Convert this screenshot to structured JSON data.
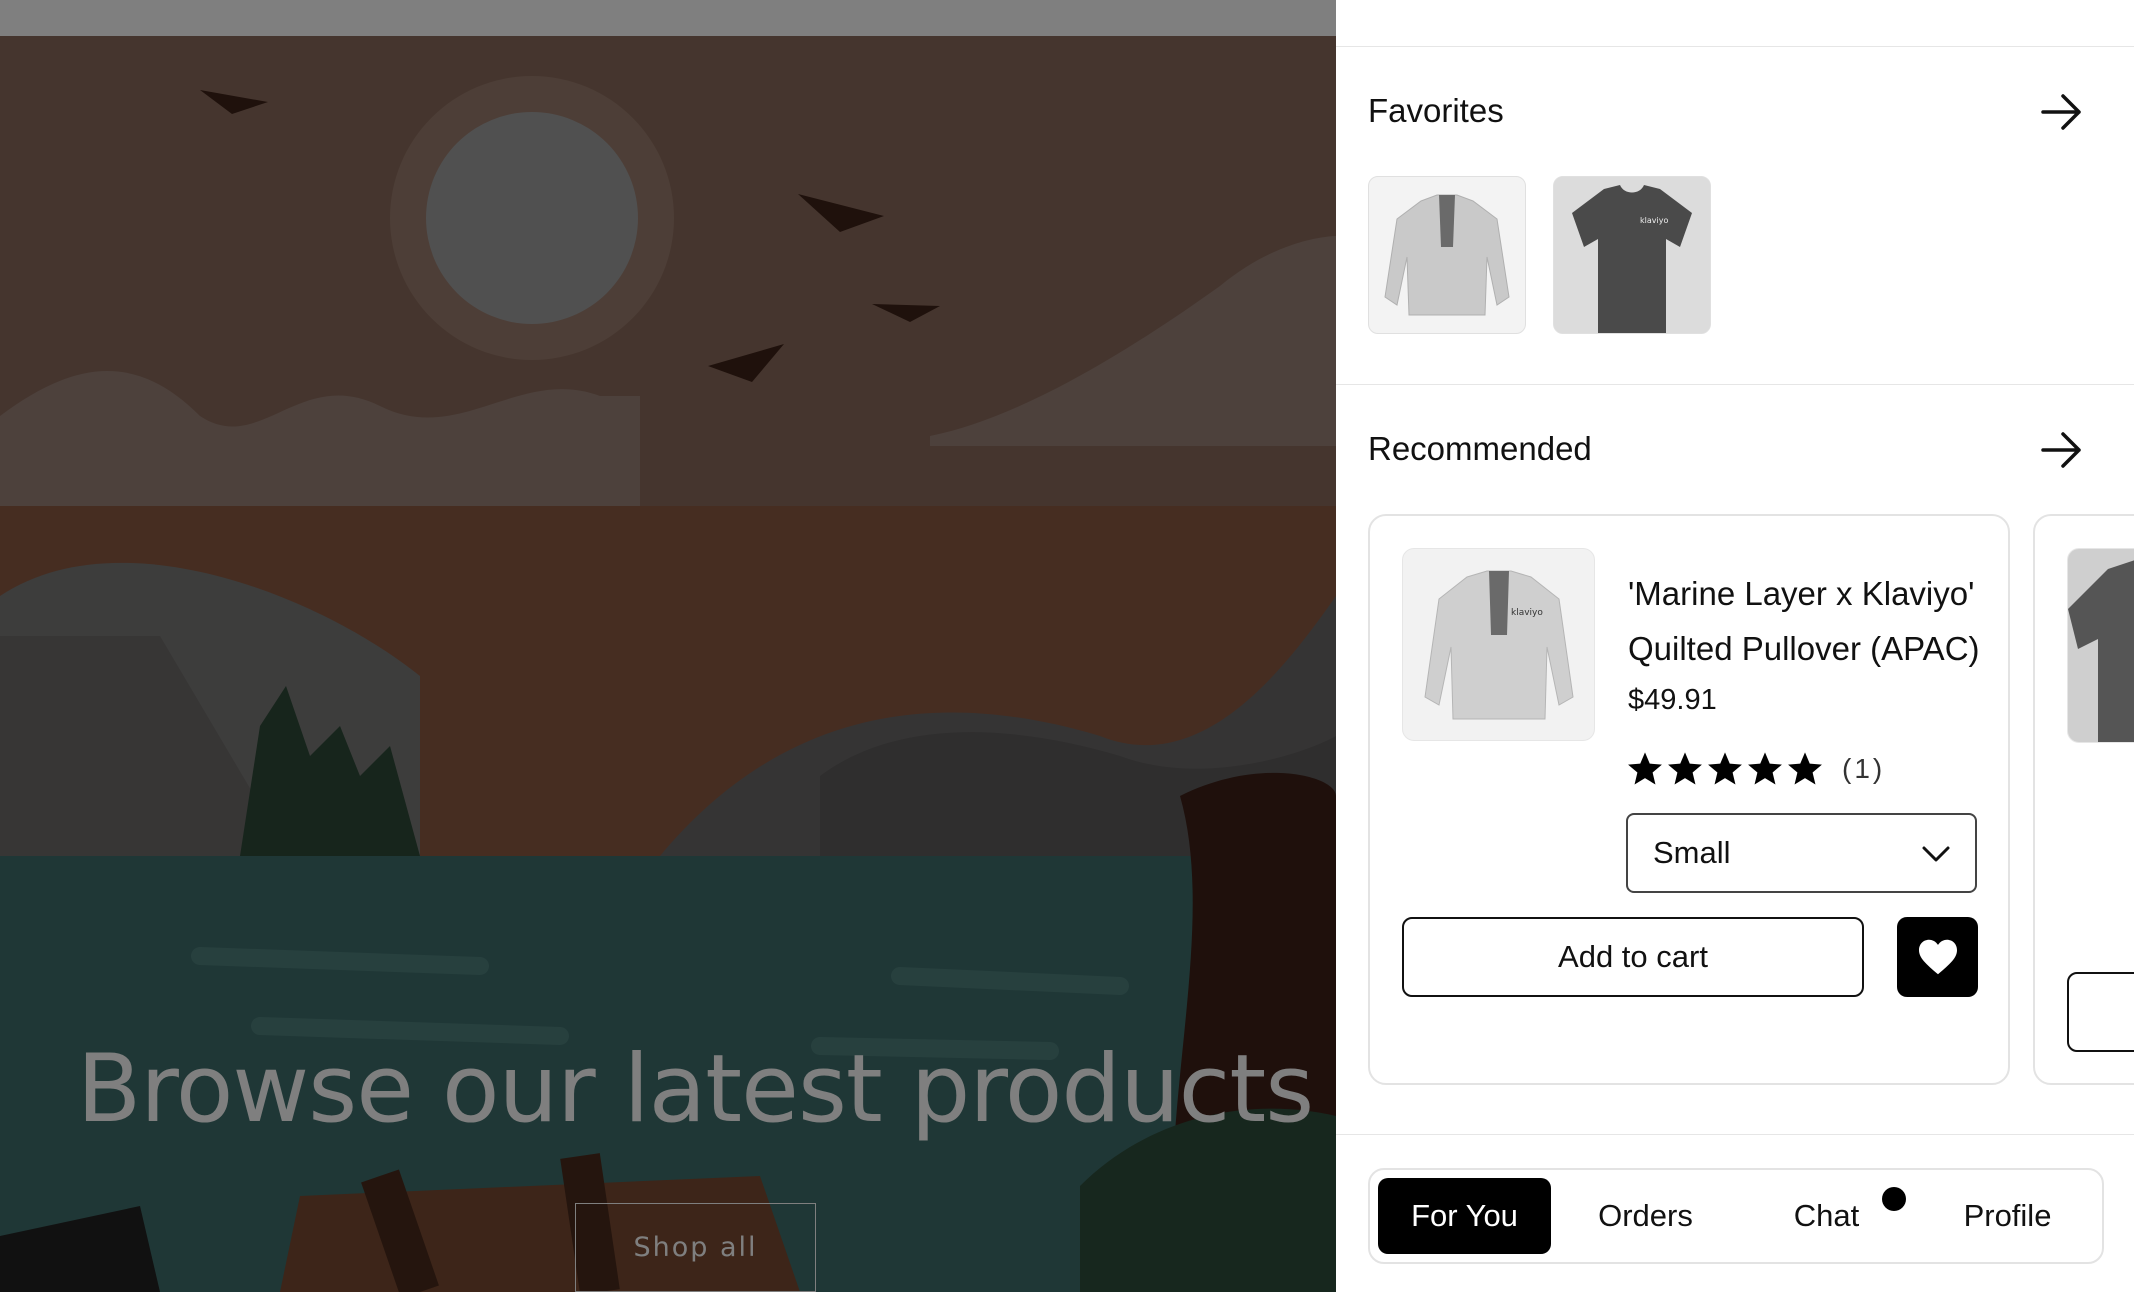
{
  "hero": {
    "title": "Browse our latest products",
    "button_label": "Shop all"
  },
  "favorites": {
    "title": "Favorites",
    "items": [
      {
        "name": "pullover-thumbnail"
      },
      {
        "name": "tshirt-thumbnail"
      }
    ]
  },
  "recommended": {
    "title": "Recommended",
    "product": {
      "name": "'Marine Layer x Klaviyo' Quilted Pullover (APAC)",
      "price": "$49.91",
      "rating": 5,
      "review_count": "(1)",
      "size": "Small",
      "add_to_cart_label": "Add to cart",
      "brand_mark": "klaviyo"
    }
  },
  "tabs": [
    {
      "label": "For You",
      "active": true
    },
    {
      "label": "Orders",
      "active": false
    },
    {
      "label": "Chat",
      "active": false,
      "badge": true
    },
    {
      "label": "Profile",
      "active": false
    }
  ],
  "icons": {
    "arrow": "arrow-right-icon",
    "heart": "heart-icon",
    "chevron": "chevron-down-icon",
    "star": "star-icon"
  },
  "colors": {
    "overlay": "rgba(0,0,0,0.5)",
    "active_tab": "#000000",
    "text": "#111111"
  }
}
